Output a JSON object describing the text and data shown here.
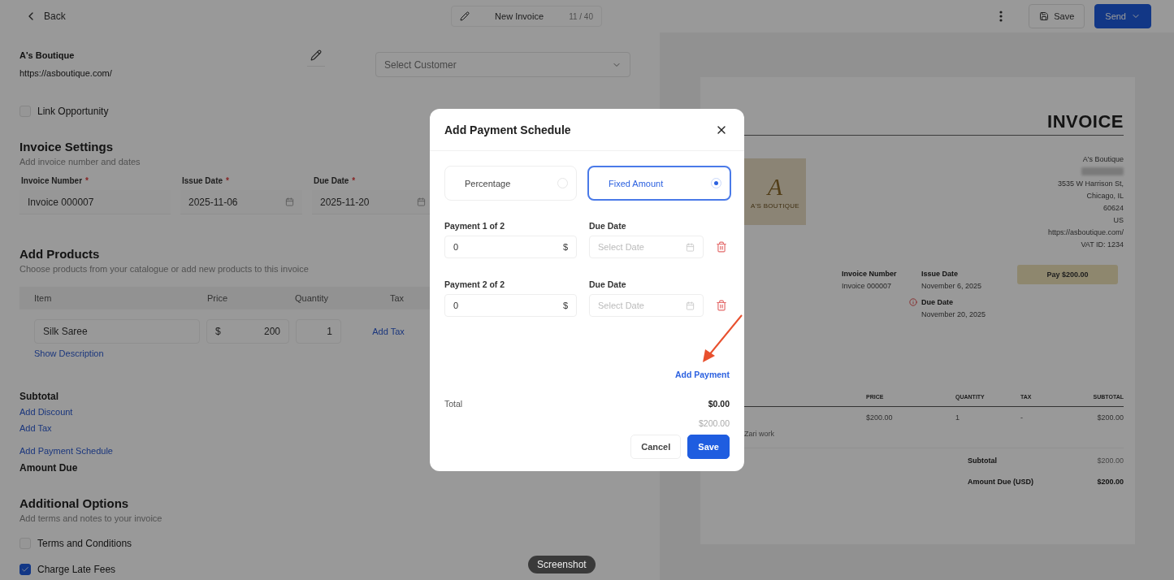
{
  "top_bar": {
    "back": "Back",
    "document": {
      "title": "New Invoice",
      "counter": "11 / 40"
    },
    "save": "Save",
    "send": "Send"
  },
  "business": {
    "name": "A's Boutique",
    "website": "https://asboutique.com/"
  },
  "customer": {
    "placeholder": "Select Customer"
  },
  "link_opportunity": {
    "label": "Link Opportunity",
    "checked": false
  },
  "invoice_settings": {
    "title": "Invoice Settings",
    "subtitle": "Add invoice number and dates",
    "fields": [
      {
        "label": "Invoice Number",
        "required_mark": "*",
        "value": "Invoice 000007",
        "kind": "text"
      },
      {
        "label": "Issue Date",
        "required_mark": "*",
        "value": "2025-11-06",
        "kind": "date"
      },
      {
        "label": "Due Date",
        "required_mark": "*",
        "value": "2025-11-20",
        "kind": "date"
      }
    ]
  },
  "products": {
    "title": "Add Products",
    "subtitle": "Choose products from your catalogue or add new products to this invoice",
    "columns": [
      "Item",
      "Price",
      "Quantity",
      "Tax"
    ],
    "rows": [
      {
        "item": "Silk Saree",
        "currency": "$",
        "price": "200",
        "quantity": "1",
        "tax_action": "Add Tax",
        "description_link": "Show Description"
      }
    ]
  },
  "totals": {
    "subtotal_label": "Subtotal",
    "links": [
      "Add Discount",
      "Add Tax"
    ],
    "schedule_link": "Add Payment Schedule",
    "amount_due_label": "Amount Due"
  },
  "additional_options": {
    "title": "Additional Options",
    "subtitle": "Add terms and notes to your invoice",
    "options": [
      {
        "label": "Terms and Conditions",
        "checked": false
      },
      {
        "label": "Charge Late Fees",
        "checked": true
      }
    ]
  },
  "preview": {
    "title": "INVOICE",
    "logo": {
      "letter": "A",
      "name": "A'S BOUTIQUE"
    },
    "address": [
      {
        "kind": "text",
        "text": "A's Boutique"
      },
      {
        "kind": "redacted"
      },
      {
        "kind": "text",
        "text": "3535 W Harrison St,"
      },
      {
        "kind": "text",
        "text": "Chicago, IL"
      },
      {
        "kind": "text",
        "text": "60624"
      },
      {
        "kind": "text",
        "text": "US"
      },
      {
        "kind": "text",
        "text": "https://asboutique.com/"
      },
      {
        "kind": "text",
        "text": "VAT ID: 1234"
      }
    ],
    "invoice_number": {
      "label": "Invoice Number",
      "value": "Invoice 000007"
    },
    "issue_date": {
      "label": "Issue Date",
      "value": "November 6, 2025"
    },
    "due_date": {
      "label": "Due Date",
      "value": "November 20, 2025",
      "warning": true
    },
    "pay_button": "Pay $200.00",
    "columns": [
      "PRICE",
      "QUANTITY",
      "TAX",
      "SUBTOTAL"
    ],
    "rows": [
      {
        "price": "$200.00",
        "quantity": "1",
        "tax": "-",
        "subtotal": "$200.00",
        "description": "Zari work"
      }
    ],
    "summary": [
      {
        "label": "Subtotal",
        "value": "$200.00",
        "emphasis": false
      },
      {
        "label": "Amount Due (USD)",
        "value": "$200.00",
        "emphasis": true
      }
    ]
  },
  "modal": {
    "title": "Add Payment Schedule",
    "modes": [
      {
        "label": "Percentage",
        "selected": false
      },
      {
        "label": "Fixed Amount",
        "selected": true
      }
    ],
    "payments": [
      {
        "label": "Payment 1 of 2",
        "amount": "0",
        "currency": "$",
        "date_label": "Due Date",
        "date_placeholder": "Select Date"
      },
      {
        "label": "Payment 2 of 2",
        "amount": "0",
        "currency": "$",
        "date_label": "Due Date",
        "date_placeholder": "Select Date"
      }
    ],
    "add_payment": "Add Payment",
    "total_label": "Total",
    "total": "$0.00",
    "target": "$200.00",
    "cancel": "Cancel",
    "save": "Save"
  },
  "tooltip": "Screenshot"
}
